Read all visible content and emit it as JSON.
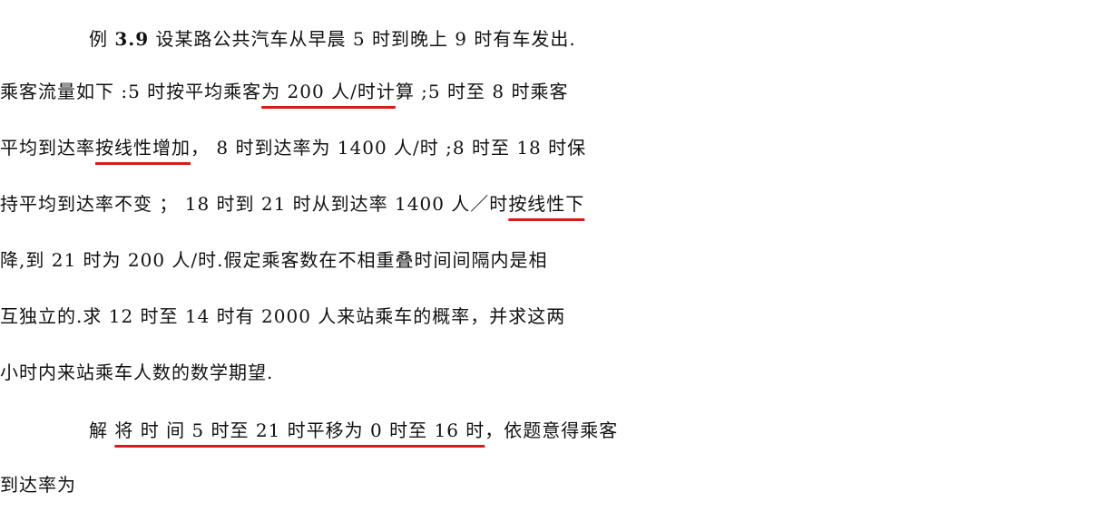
{
  "example": {
    "label": "例",
    "number": "3.9",
    "lines": [
      [
        {
          "t": "设某路公共汽车从早晨 5 时到晚上 9 时有车发出.",
          "u": false
        }
      ],
      [
        {
          "t": "乘客流量如下 :5 时按平均乘客",
          "u": false
        },
        {
          "t": "为 200 人/时计",
          "u": true
        },
        {
          "t": "算 ;5 时至 8 时乘客",
          "u": false
        }
      ],
      [
        {
          "t": "平均到达率",
          "u": false
        },
        {
          "t": "按线性增加",
          "u": true
        },
        {
          "t": "， 8 时到达率为 1400 人/时 ;8 时至 18 时保",
          "u": false
        }
      ],
      [
        {
          "t": "持平均到达率不变 ； 18 时到 21 时从到达率 1400 人／时",
          "u": false
        },
        {
          "t": "按线性下",
          "u": true
        }
      ],
      [
        {
          "t": "降,到 21 时为 200 人/时.假定乘客数在不相重叠时间间隔内是相",
          "u": false
        }
      ],
      [
        {
          "t": "互独立的.求 12 时至 14 时有 2000 人来站乘车的概率，并求这两",
          "u": false
        }
      ],
      [
        {
          "t": "小时内来站乘车人数的数学期望.",
          "u": false
        }
      ]
    ]
  },
  "solution": {
    "label": "解",
    "lines": [
      [
        {
          "t": "将 时 间 5 时至 21 时平移为 0 时至 16 时",
          "u": true
        },
        {
          "t": "，依题意得乘客",
          "u": false
        }
      ],
      [
        {
          "t": "到达率为",
          "u": false
        }
      ]
    ]
  },
  "colors": {
    "text": "#111111",
    "underline": "#d81b1b"
  }
}
